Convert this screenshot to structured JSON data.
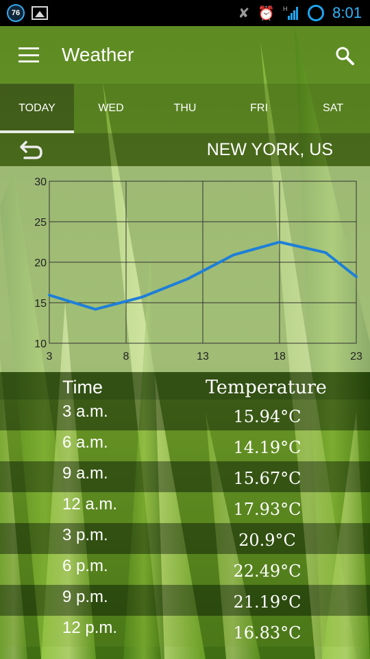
{
  "statusbar": {
    "badge_text": "76",
    "time": "8:01",
    "network_label": "H"
  },
  "header": {
    "title": "Weather"
  },
  "tabs": [
    {
      "label": "TODAY",
      "active": true
    },
    {
      "label": "WED",
      "active": false
    },
    {
      "label": "THU",
      "active": false
    },
    {
      "label": "FRI",
      "active": false
    },
    {
      "label": "SAT",
      "active": false
    }
  ],
  "location": "NEW YORK, US",
  "chart_data": {
    "type": "line",
    "x": [
      3,
      6,
      9,
      12,
      15,
      18,
      21,
      23
    ],
    "series": [
      {
        "values": [
          15.94,
          14.19,
          15.67,
          17.93,
          20.9,
          22.49,
          21.19,
          18.2
        ]
      }
    ],
    "xticks": [
      "3",
      "8",
      "13",
      "18",
      "23"
    ],
    "yticks": [
      "10",
      "15",
      "20",
      "25",
      "30"
    ],
    "xlim": [
      3,
      23
    ],
    "ylim": [
      10,
      30
    ],
    "grid": true,
    "line_color": "#1e7fd8"
  },
  "table": {
    "headers": {
      "time": "Time",
      "temperature": "Temperature"
    },
    "rows": [
      {
        "time": "3 a.m.",
        "temp": "15.94°C"
      },
      {
        "time": "6 a.m.",
        "temp": "14.19°C"
      },
      {
        "time": "9 a.m.",
        "temp": "15.67°C"
      },
      {
        "time": "12 a.m.",
        "temp": "17.93°C"
      },
      {
        "time": "3 p.m.",
        "temp": "20.9°C"
      },
      {
        "time": "6 p.m.",
        "temp": "22.49°C"
      },
      {
        "time": "9 p.m.",
        "temp": "21.19°C"
      },
      {
        "time": "12 p.m.",
        "temp": "16.83°C"
      }
    ]
  }
}
